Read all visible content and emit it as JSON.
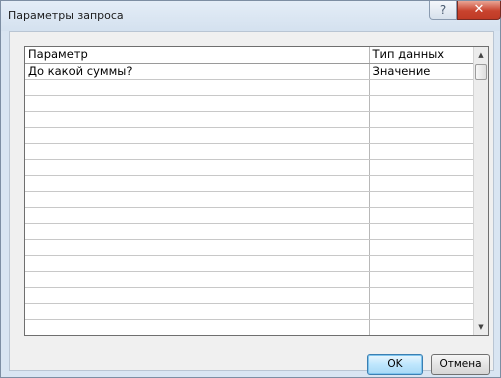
{
  "window": {
    "title": "Параметры запроса",
    "help_label": "?",
    "close_label": "✕"
  },
  "grid": {
    "columns": [
      "Параметр",
      "Тип данных"
    ],
    "rows": [
      [
        "До какой суммы?",
        "Значение"
      ],
      [
        "",
        ""
      ],
      [
        "",
        ""
      ],
      [
        "",
        ""
      ],
      [
        "",
        ""
      ],
      [
        "",
        ""
      ],
      [
        "",
        ""
      ],
      [
        "",
        ""
      ],
      [
        "",
        ""
      ],
      [
        "",
        ""
      ],
      [
        "",
        ""
      ],
      [
        "",
        ""
      ],
      [
        "",
        ""
      ],
      [
        "",
        ""
      ],
      [
        "",
        ""
      ],
      [
        "",
        ""
      ],
      [
        "",
        ""
      ]
    ],
    "scroll_up_icon": "▲",
    "scroll_down_icon": "▼"
  },
  "buttons": {
    "ok_label": "OK",
    "cancel_label": "Отмена"
  }
}
